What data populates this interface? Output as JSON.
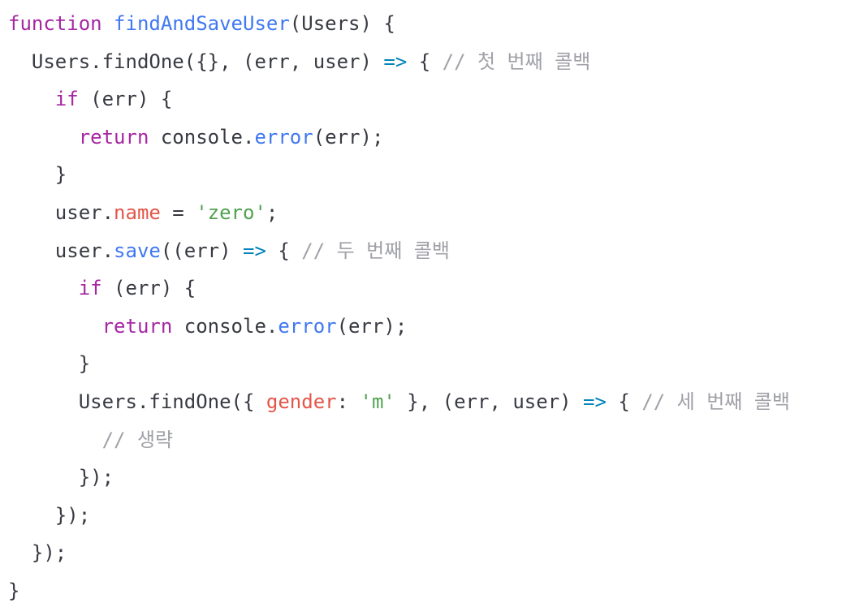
{
  "code": {
    "lines": [
      [
        {
          "t": "function",
          "c": "kw"
        },
        {
          "t": " ",
          "c": "pl"
        },
        {
          "t": "findAndSaveUser",
          "c": "fn"
        },
        {
          "t": "(Users) {",
          "c": "pl"
        }
      ],
      [
        {
          "t": "  Users.",
          "c": "pl"
        },
        {
          "t": "findOne",
          "c": "pl"
        },
        {
          "t": "({}, (err, user) ",
          "c": "pl"
        },
        {
          "t": "=>",
          "c": "op"
        },
        {
          "t": " { ",
          "c": "pl"
        },
        {
          "t": "// 첫 번째 콜백",
          "c": "cm"
        }
      ],
      [
        {
          "t": "    ",
          "c": "pl"
        },
        {
          "t": "if",
          "c": "kw"
        },
        {
          "t": " (err) {",
          "c": "pl"
        }
      ],
      [
        {
          "t": "      ",
          "c": "pl"
        },
        {
          "t": "return",
          "c": "kw"
        },
        {
          "t": " console.",
          "c": "pl"
        },
        {
          "t": "error",
          "c": "fn"
        },
        {
          "t": "(err);",
          "c": "pl"
        }
      ],
      [
        {
          "t": "    }",
          "c": "pl"
        }
      ],
      [
        {
          "t": "    user.",
          "c": "pl"
        },
        {
          "t": "name",
          "c": "prop"
        },
        {
          "t": " = ",
          "c": "pl"
        },
        {
          "t": "'zero'",
          "c": "str"
        },
        {
          "t": ";",
          "c": "pl"
        }
      ],
      [
        {
          "t": "    user.",
          "c": "pl"
        },
        {
          "t": "save",
          "c": "fn"
        },
        {
          "t": "((err) ",
          "c": "pl"
        },
        {
          "t": "=>",
          "c": "op"
        },
        {
          "t": " { ",
          "c": "pl"
        },
        {
          "t": "// 두 번째 콜백",
          "c": "cm"
        }
      ],
      [
        {
          "t": "      ",
          "c": "pl"
        },
        {
          "t": "if",
          "c": "kw"
        },
        {
          "t": " (err) {",
          "c": "pl"
        }
      ],
      [
        {
          "t": "        ",
          "c": "pl"
        },
        {
          "t": "return",
          "c": "kw"
        },
        {
          "t": " console.",
          "c": "pl"
        },
        {
          "t": "error",
          "c": "fn"
        },
        {
          "t": "(err);",
          "c": "pl"
        }
      ],
      [
        {
          "t": "      }",
          "c": "pl"
        }
      ],
      [
        {
          "t": "      Users.findOne({ ",
          "c": "pl"
        },
        {
          "t": "gender",
          "c": "prop"
        },
        {
          "t": ": ",
          "c": "pl"
        },
        {
          "t": "'m'",
          "c": "str"
        },
        {
          "t": " }, (err, user) ",
          "c": "pl"
        },
        {
          "t": "=>",
          "c": "op"
        },
        {
          "t": " { ",
          "c": "pl"
        },
        {
          "t": "// 세 번째 콜백",
          "c": "cm"
        }
      ],
      [
        {
          "t": "        ",
          "c": "pl"
        },
        {
          "t": "// 생략",
          "c": "cm"
        }
      ],
      [
        {
          "t": "      });",
          "c": "pl"
        }
      ],
      [
        {
          "t": "    });",
          "c": "pl"
        }
      ],
      [
        {
          "t": "  });",
          "c": "pl"
        }
      ],
      [
        {
          "t": "}",
          "c": "pl"
        }
      ]
    ]
  }
}
